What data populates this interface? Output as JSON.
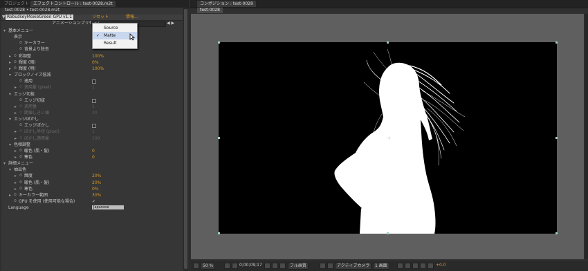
{
  "left_panel": {
    "tabs": [
      "プロジェクト",
      "エフェクトコントロール : test-0028.m2t"
    ],
    "subtitle": "test-0028 • test-0028.m2t",
    "effect_name": "RobuskeyMoxieGreen GPU v1.1",
    "reset_label": "リセット",
    "about_label": "情報...",
    "preset_label": "アニメーションプリセット：",
    "preset_value": "なし",
    "preset_arrows": "◀ ▶"
  },
  "params": [
    {
      "kind": "group",
      "text": "基本メニュー",
      "level": 0,
      "expanded": true
    },
    {
      "kind": "label",
      "text": "表示",
      "level": 1
    },
    {
      "kind": "param",
      "text": "キーカラー",
      "level": 2,
      "stopwatch": true
    },
    {
      "kind": "param",
      "text": "背景より除去",
      "level": 2,
      "stopwatch": true
    },
    {
      "kind": "param",
      "text": "彩調整",
      "level": 1,
      "stopwatch": true,
      "twirl": true,
      "value": "100%"
    },
    {
      "kind": "param",
      "text": "輝度 (暗)",
      "level": 1,
      "stopwatch": true,
      "twirl": true,
      "value": "0%"
    },
    {
      "kind": "param",
      "text": "輝度 (明)",
      "level": 1,
      "stopwatch": true,
      "twirl": true,
      "value": "100%"
    },
    {
      "kind": "group",
      "text": "ブロックノイズ低減",
      "level": 1,
      "expanded": true
    },
    {
      "kind": "param",
      "text": "適用",
      "level": 2,
      "stopwatch": true,
      "checkbox": true
    },
    {
      "kind": "param",
      "text": "適用量 (pixel)",
      "level": 2,
      "stopwatch": true,
      "twirl": true,
      "value": "1",
      "dim": true
    },
    {
      "kind": "group",
      "text": "エッジ切抜",
      "level": 1,
      "expanded": true
    },
    {
      "kind": "param",
      "text": "エッジ切抜",
      "level": 2,
      "stopwatch": true,
      "checkbox": true
    },
    {
      "kind": "param",
      "text": "適用量",
      "level": 2,
      "stopwatch": true,
      "twirl": true,
      "value": "1",
      "dim": true
    },
    {
      "kind": "param",
      "text": "閾値しきい値",
      "level": 2,
      "stopwatch": true,
      "twirl": true,
      "value": "30",
      "dim": true
    },
    {
      "kind": "group",
      "text": "エッジぼかし",
      "level": 1,
      "expanded": true
    },
    {
      "kind": "param",
      "text": "エッジぼかし",
      "level": 2,
      "stopwatch": true,
      "checkbox": true
    },
    {
      "kind": "param",
      "text": "ぼかし半径 (pixel)",
      "level": 2,
      "stopwatch": true,
      "twirl": true,
      "value": "1",
      "dim": true
    },
    {
      "kind": "param",
      "text": "ぼかし適用量",
      "level": 2,
      "stopwatch": true,
      "twirl": true,
      "value": "100",
      "dim": true
    },
    {
      "kind": "group",
      "text": "色相調整",
      "level": 1,
      "expanded": true
    },
    {
      "kind": "param",
      "text": "暖色 (肌・髪)",
      "level": 2,
      "stopwatch": true,
      "twirl": true,
      "value": "0"
    },
    {
      "kind": "param",
      "text": "寒色",
      "level": 2,
      "stopwatch": true,
      "twirl": true,
      "value": "0"
    },
    {
      "kind": "group",
      "text": "詳細メニュー",
      "level": 0,
      "expanded": true
    },
    {
      "kind": "group",
      "text": "抽出色",
      "level": 1,
      "expanded": true
    },
    {
      "kind": "param",
      "text": "輝度",
      "level": 2,
      "stopwatch": true,
      "twirl": true,
      "value": "20%"
    },
    {
      "kind": "param",
      "text": "暖色 (肌・髪)",
      "level": 2,
      "stopwatch": true,
      "twirl": true,
      "value": "20%"
    },
    {
      "kind": "param",
      "text": "寒色",
      "level": 2,
      "stopwatch": true,
      "twirl": true,
      "value": "0%"
    },
    {
      "kind": "param",
      "text": "キーカラー範囲",
      "level": 1,
      "stopwatch": true,
      "twirl": true,
      "value": "30%"
    },
    {
      "kind": "param",
      "text": "GPU を使用 (使用可能な場合)",
      "level": 1,
      "stopwatch": true,
      "checked": true
    },
    {
      "kind": "lang",
      "text": "Language",
      "level": 0,
      "value": "Japanese"
    }
  ],
  "display_menu": {
    "items": [
      {
        "label": "Source",
        "checked": false
      },
      {
        "label": "Matte",
        "checked": true
      },
      {
        "label": "Result",
        "checked": false
      }
    ]
  },
  "right_panel": {
    "tab": "コンポジション : test-0028",
    "subtab": "test-0028"
  },
  "bottom_bar": {
    "zoom": "50 %",
    "timecode": "0;00;09;17",
    "resolution": "フル画質",
    "camera": "アクティブカメラ",
    "views": "1 画面",
    "exposure": "+0.0"
  },
  "colors": {
    "accent_value": "#d89a28",
    "panel_bg": "#363636",
    "viewer_bg": "#5f5f5f",
    "comp_bg": "#000000"
  }
}
